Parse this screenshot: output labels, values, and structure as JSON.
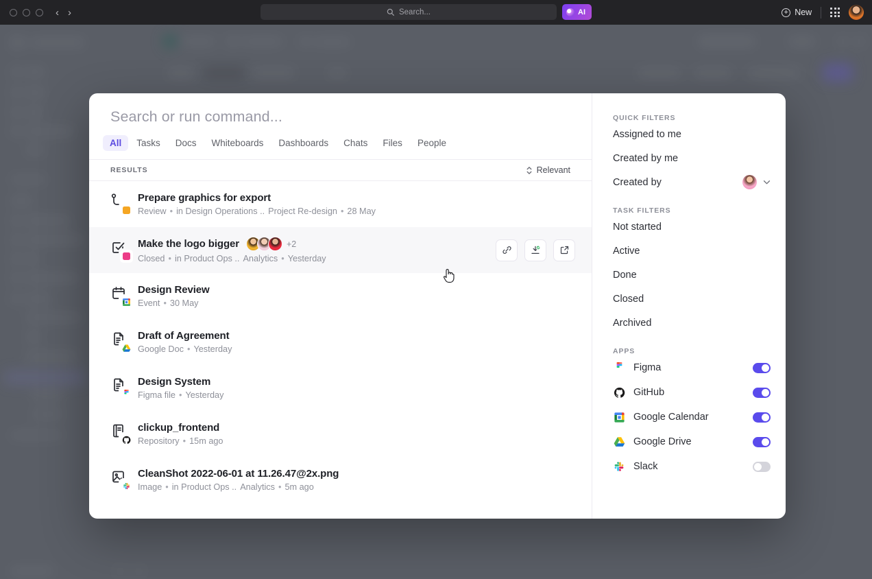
{
  "titlebar": {
    "window_controls": [
      "close",
      "minimize",
      "maximize"
    ],
    "back_icon": "‹",
    "forward_icon": "›",
    "search": {
      "placeholder": "Search...",
      "icon": "search-icon"
    },
    "ai_label": "AI",
    "new_label": "New",
    "plus_glyph": "+",
    "apps_grid_icon": "apps-grid-icon",
    "avatar_icon": "user-avatar"
  },
  "modal": {
    "search": {
      "value": "",
      "placeholder": "Search or run command..."
    },
    "tabs": [
      {
        "label": "All",
        "active": true
      },
      {
        "label": "Tasks",
        "active": false
      },
      {
        "label": "Docs",
        "active": false
      },
      {
        "label": "Whiteboards",
        "active": false
      },
      {
        "label": "Dashboards",
        "active": false
      },
      {
        "label": "Chats",
        "active": false
      },
      {
        "label": "Files",
        "active": false
      },
      {
        "label": "People",
        "active": false
      }
    ],
    "results_label": "RESULTS",
    "sort": {
      "label": "Relevant",
      "icon": "sort-updown-icon"
    },
    "results": [
      {
        "title": "Prepare graphics for export",
        "icon": "task-subtask-icon",
        "status_color": "#f5a623",
        "meta": "Review",
        "location": "in Design Operations ..",
        "list": "Project Re-design",
        "date": "28 May",
        "hovered": false
      },
      {
        "title": "Make the logo bigger",
        "icon": "task-checkbox-icon",
        "status_color": "#ec3d87",
        "meta": "Closed",
        "location": "in Product Ops ..",
        "list": "Analytics",
        "date": "Yesterday",
        "hovered": true,
        "assignees_overflow": "+2",
        "actions": [
          {
            "name": "copy-link-button",
            "icon": "link-icon"
          },
          {
            "name": "merge-task-button",
            "icon": "download-check-icon"
          },
          {
            "name": "open-in-new-button",
            "icon": "external-link-icon"
          }
        ]
      },
      {
        "title": "Design Review",
        "icon": "calendar-icon",
        "app_badge": "google-calendar-icon",
        "meta": "Event",
        "date": "30 May",
        "hovered": false
      },
      {
        "title": "Draft of Agreement",
        "icon": "document-icon",
        "app_badge": "google-drive-icon",
        "meta": "Google Doc",
        "date": "Yesterday",
        "hovered": false
      },
      {
        "title": "Design System",
        "icon": "document-icon",
        "app_badge": "figma-icon",
        "meta": "Figma file",
        "date": "Yesterday",
        "hovered": false
      },
      {
        "title": "clickup_frontend",
        "icon": "repository-icon",
        "app_badge": "github-icon",
        "meta": "Repository",
        "date": "15m ago",
        "hovered": false
      },
      {
        "title": "CleanShot 2022-06-01 at 11.26.47@2x.png",
        "icon": "image-icon",
        "app_badge": "slack-icon",
        "meta": "Image",
        "location": "in Product Ops ..",
        "list": "Analytics",
        "date": "5m ago",
        "hovered": false
      }
    ]
  },
  "sidebar": {
    "quick_filters_label": "QUICK FILTERS",
    "quick_filters": [
      {
        "label": "Assigned to me"
      },
      {
        "label": "Created by me"
      },
      {
        "label": "Created by",
        "has_avatar": true,
        "chevron": "⌄"
      }
    ],
    "task_filters_label": "TASK FILTERS",
    "task_filters": [
      {
        "label": "Not started"
      },
      {
        "label": "Active"
      },
      {
        "label": "Done"
      },
      {
        "label": "Closed"
      },
      {
        "label": "Archived"
      }
    ],
    "apps_label": "APPS",
    "apps": [
      {
        "label": "Figma",
        "icon": "figma-icon",
        "enabled": true
      },
      {
        "label": "GitHub",
        "icon": "github-icon",
        "enabled": true
      },
      {
        "label": "Google Calendar",
        "icon": "google-calendar-icon",
        "enabled": true
      },
      {
        "label": "Google Drive",
        "icon": "google-drive-icon",
        "enabled": true
      },
      {
        "label": "Slack",
        "icon": "slack-icon",
        "enabled": false
      }
    ]
  },
  "colors": {
    "accent": "#5a4bec",
    "accent_soft": "#f0eefd",
    "backdrop": "#5a5e66",
    "titlebar": "#232326",
    "hover_row": "#f7f7f9"
  }
}
